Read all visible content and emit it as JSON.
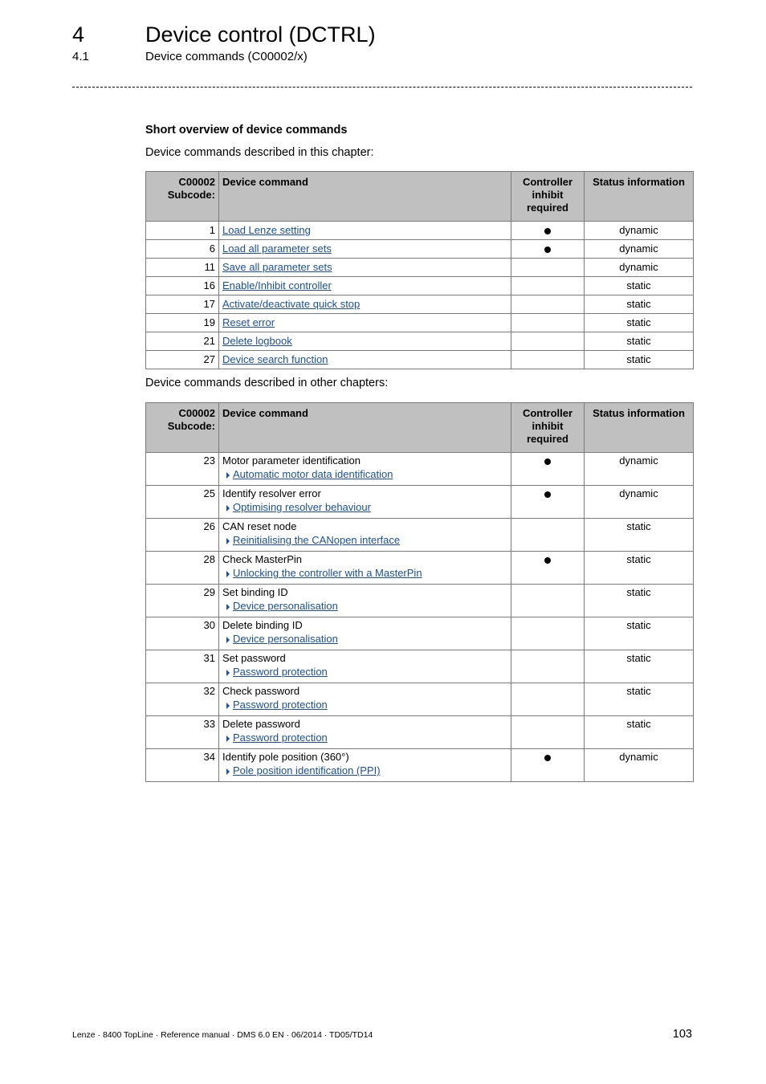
{
  "header": {
    "chapter_number": "4",
    "chapter_title": "Device control (DCTRL)",
    "section_number": "4.1",
    "section_title": "Device commands (C00002/x)"
  },
  "content": {
    "heading": "Short overview of device commands",
    "intro_this_chapter": "Device commands described in this chapter:",
    "intro_other_chapters": "Device commands described in other chapters:"
  },
  "table_headers": {
    "subcode_line1": "C00002",
    "subcode_line2": "Subcode:",
    "command": "Device command",
    "inhibit_line1": "Controller",
    "inhibit_line2": "inhibit",
    "inhibit_line3": "required",
    "status": "Status information"
  },
  "table1": [
    {
      "subcode": "1",
      "command": "Load Lenze setting",
      "inhibit": true,
      "status": "dynamic"
    },
    {
      "subcode": "6",
      "command": "Load all parameter sets",
      "inhibit": true,
      "status": "dynamic"
    },
    {
      "subcode": "11",
      "command": "Save all parameter sets",
      "inhibit": false,
      "status": "dynamic"
    },
    {
      "subcode": "16",
      "command": "Enable/Inhibit controller",
      "inhibit": false,
      "status": "static"
    },
    {
      "subcode": "17",
      "command": "Activate/deactivate quick stop",
      "inhibit": false,
      "status": "static"
    },
    {
      "subcode": "19",
      "command": "Reset error",
      "inhibit": false,
      "status": "static"
    },
    {
      "subcode": "21",
      "command": "Delete logbook",
      "inhibit": false,
      "status": "static"
    },
    {
      "subcode": "27",
      "command": "Device search function",
      "inhibit": false,
      "status": "static"
    }
  ],
  "table2": [
    {
      "subcode": "23",
      "command": "Motor parameter identification",
      "link": "Automatic motor data identification",
      "inhibit": true,
      "status": "dynamic"
    },
    {
      "subcode": "25",
      "command": "Identify resolver error",
      "link": "Optimising resolver behaviour",
      "inhibit": true,
      "status": "dynamic"
    },
    {
      "subcode": "26",
      "command": "CAN reset node",
      "link": "Reinitialising the CANopen interface",
      "inhibit": false,
      "status": "static"
    },
    {
      "subcode": "28",
      "command": "Check MasterPin",
      "link": "Unlocking the controller with a MasterPin",
      "inhibit": true,
      "status": "static"
    },
    {
      "subcode": "29",
      "command": "Set binding ID",
      "link": "Device personalisation",
      "inhibit": false,
      "status": "static"
    },
    {
      "subcode": "30",
      "command": "Delete binding ID",
      "link": "Device personalisation",
      "inhibit": false,
      "status": "static"
    },
    {
      "subcode": "31",
      "command": "Set password",
      "link": "Password protection",
      "inhibit": false,
      "status": "static"
    },
    {
      "subcode": "32",
      "command": "Check password",
      "link": "Password protection",
      "inhibit": false,
      "status": "static"
    },
    {
      "subcode": "33",
      "command": "Delete password",
      "link": "Password protection",
      "inhibit": false,
      "status": "static"
    },
    {
      "subcode": "34",
      "command": "Identify pole position (360°)",
      "link": "Pole position identification (PPI)",
      "inhibit": true,
      "status": "dynamic"
    }
  ],
  "footer": {
    "text": "Lenze · 8400 TopLine · Reference manual · DMS 6.0 EN · 06/2014 · TD05/TD14",
    "page_number": "103"
  },
  "colors": {
    "link": "#1a4f9c",
    "header_bg": "#c0c0c0"
  }
}
